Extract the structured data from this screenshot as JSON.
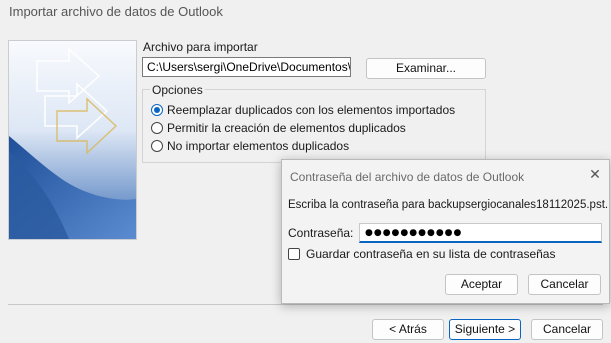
{
  "window": {
    "title": "Importar archivo de datos de Outlook"
  },
  "main": {
    "file_label": "Archivo para importar",
    "file_path": "C:\\Users\\sergi\\OneDrive\\Documentos\\Ar",
    "browse_label": "Examinar...",
    "options_legend": "Opciones",
    "options": [
      {
        "label": "Reemplazar duplicados con los elementos importados",
        "selected": true
      },
      {
        "label": "Permitir la creación de elementos duplicados",
        "selected": false
      },
      {
        "label": "No importar elementos duplicados",
        "selected": false
      }
    ]
  },
  "footer": {
    "back_label": "< Atrás",
    "next_label": "Siguiente >",
    "cancel_label": "Cancelar"
  },
  "password_dialog": {
    "title": "Contraseña del archivo de datos de Outlook",
    "close_glyph": "✕",
    "prompt": "Escriba la contraseña para backupsergiocanales18112025.pst.",
    "password_label": "Contraseña:",
    "password_masked": "●●●●●●●●●●●",
    "save_password_label": "Guardar contraseña en su lista de contraseñas",
    "save_password_checked": false,
    "ok_label": "Aceptar",
    "cancel_label": "Cancelar"
  },
  "colors": {
    "accent": "#0a64c2",
    "banner_blue": "#2f5fa8"
  },
  "icons": [
    "wizard-banner-graphic",
    "close-icon"
  ]
}
